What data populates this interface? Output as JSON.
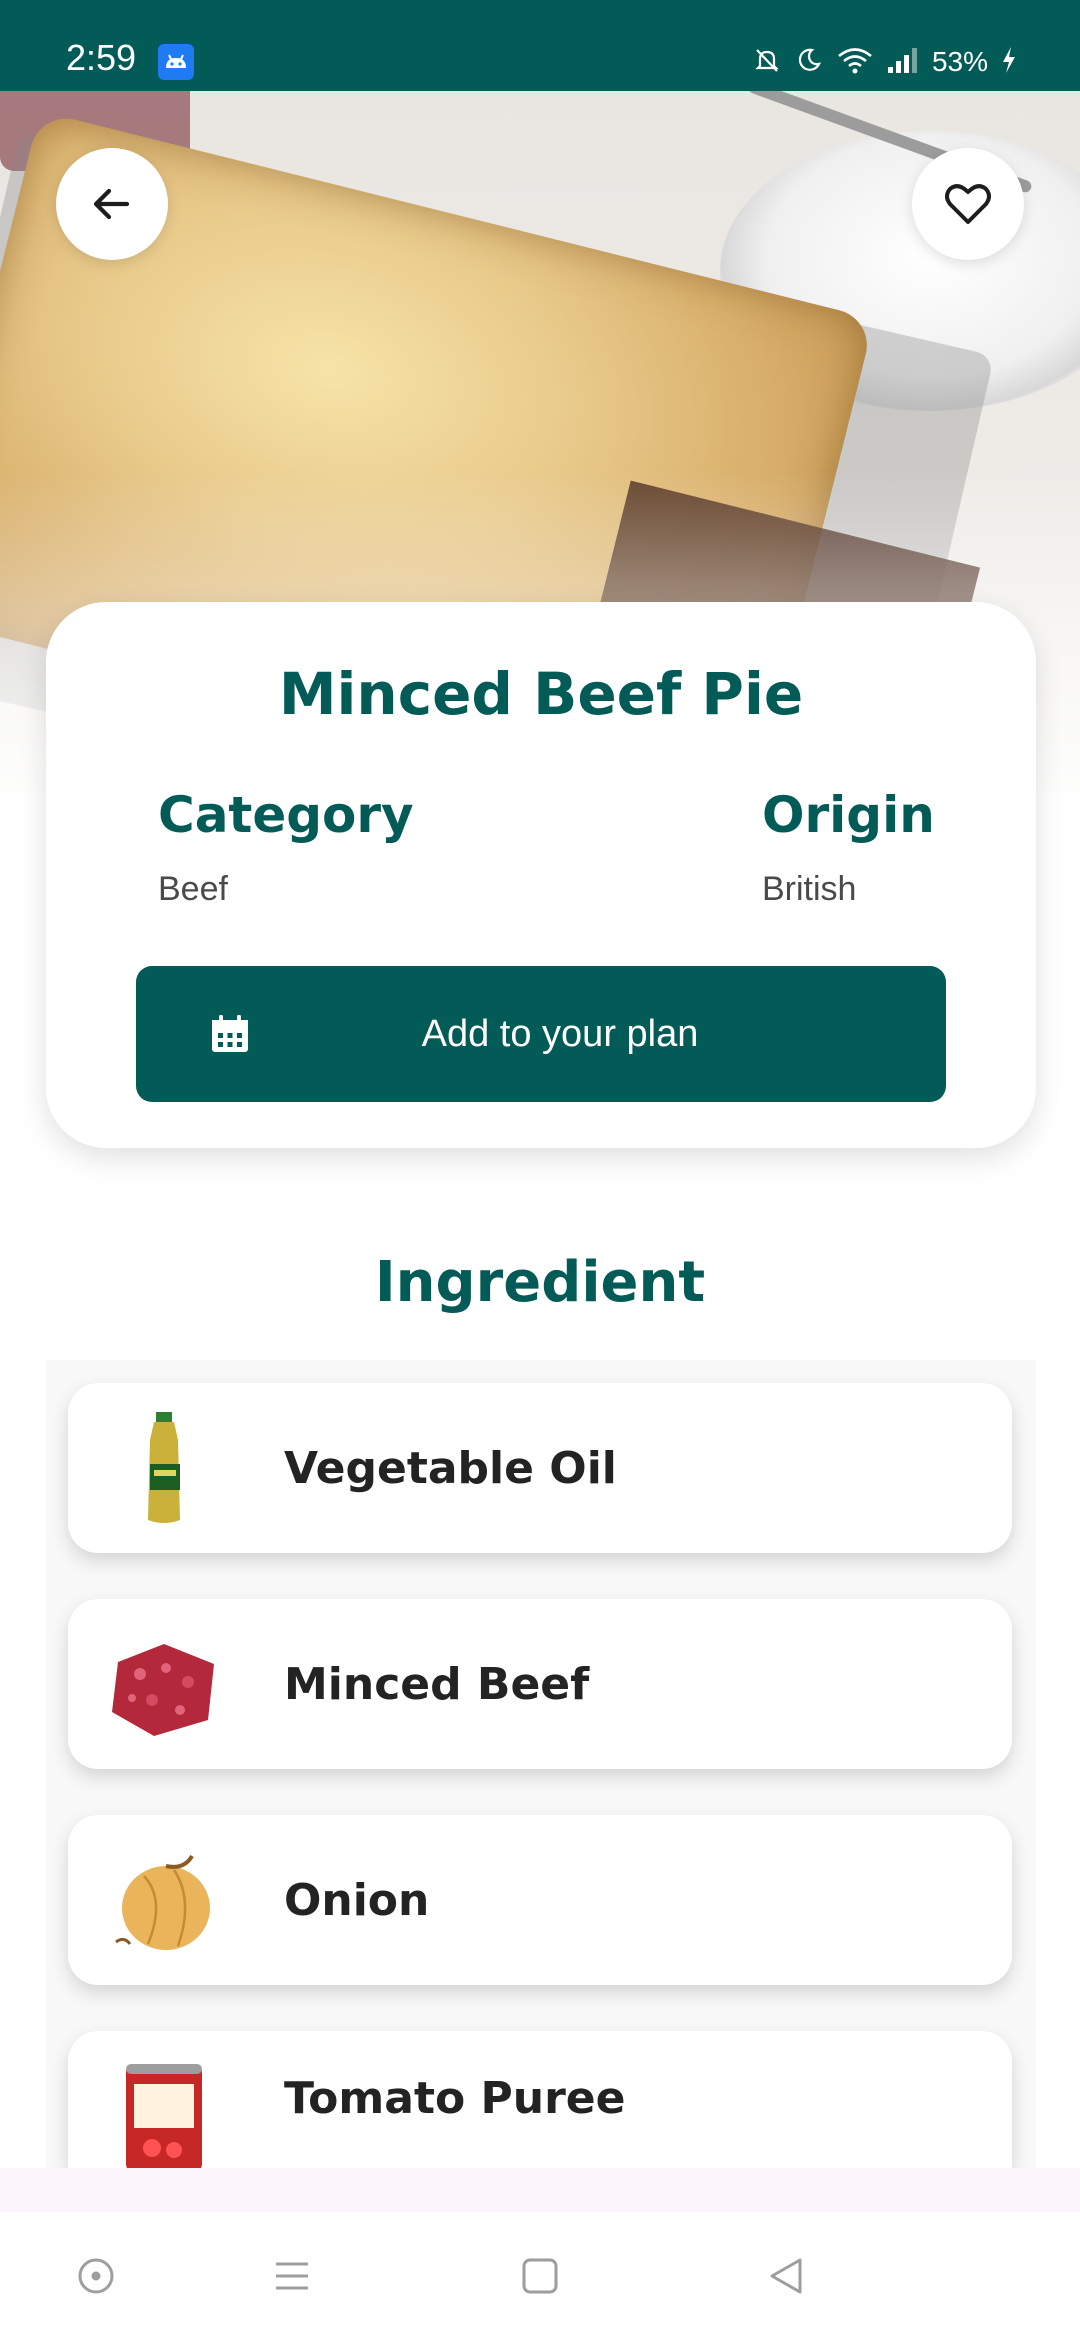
{
  "status_bar": {
    "time": "2:59",
    "battery": "53%",
    "icons": [
      "android-app-icon",
      "bell-off-icon",
      "moon-icon",
      "wifi-icon",
      "signal-icon",
      "battery-charging-icon"
    ]
  },
  "hero": {
    "image": "minced-beef-pie-photo"
  },
  "meal": {
    "title": "Minced Beef Pie",
    "category_label": "Category",
    "category_value": "Beef",
    "origin_label": "Origin",
    "origin_value": "British",
    "plan_button_label": "Add to your plan"
  },
  "ingredients": {
    "section_title": "Ingredient",
    "items": [
      {
        "name": "Vegetable Oil",
        "icon": "vegetable-oil-bottle"
      },
      {
        "name": "Minced Beef",
        "icon": "minced-beef-meat"
      },
      {
        "name": "Onion",
        "icon": "onion"
      },
      {
        "name": "Tomato Puree",
        "icon": "tomato-puree-can"
      }
    ]
  },
  "nav_bar": {
    "items": [
      "dot-icon",
      "menu-icon",
      "home-square-icon",
      "back-triangle-icon"
    ]
  },
  "colors": {
    "primary": "#025b56",
    "card": "#ffffff",
    "text_dark": "#232323",
    "text_muted": "#4a4a4a"
  }
}
